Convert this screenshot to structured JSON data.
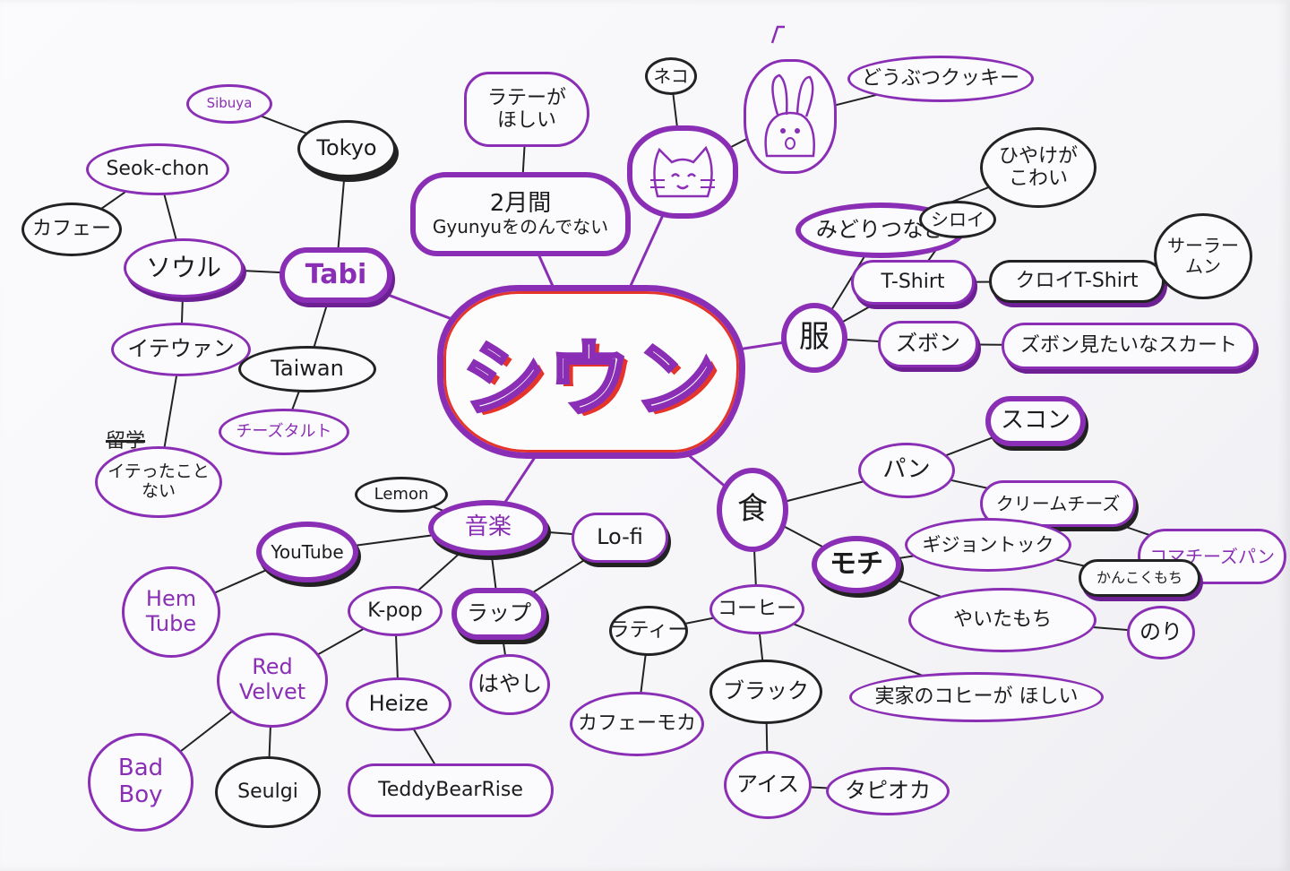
{
  "center": {
    "label": "シウン"
  },
  "nodes": {
    "tabi": "Tabi",
    "tokyo": "Tokyo",
    "shibuya": "Sibuya",
    "seoul": "ソウル",
    "seokchon": "Seok-chon",
    "cafe": "カフェー",
    "itaewon": "イテウァン",
    "taiwan": "Taiwan",
    "cheesetart": "チーズタルト",
    "notbeen_1": "イテったこと",
    "notbeen_2": "ない",
    "gyunyu_1": "2月間",
    "gyunyu_2": "Gyunyuをのんでない",
    "latte_1": "ラテーが",
    "latte_2": "ほしい",
    "neko": "ネコ",
    "animalcookie": "どうぶつクッキー",
    "midori": "みどりつなぎ",
    "hiyake_1": "ひやけが",
    "hiyake_2": "こわい",
    "shiroi": "シロイ",
    "fuku": "服",
    "tshirt": "T-Shirt",
    "kuroi": "クロイT-Shirt",
    "sailor_1": "サーラー",
    "sailor_2": "ムン",
    "zubon": "ズボン",
    "skirt": "ズボン見たいなスカート",
    "shoku": "食",
    "pan": "パン",
    "scone": "スコン",
    "creamcheese": "クリームチーズ",
    "komachi": "コマチーズパン",
    "mochi": "モチ",
    "gijeolttok": "ギジョントック",
    "kankoku": "かんこくもち",
    "yaita": "やいたもち",
    "nori": "のり",
    "coffee": "コーヒー",
    "lattie": "ラティー",
    "cafemocha": "カフェーモカ",
    "black": "ブラック",
    "jikka": "実家のコヒーが ほしい",
    "ice": "アイス",
    "tapioca": "タピオカ",
    "ongaku": "音楽",
    "lemon": "Lemon",
    "lofi": "Lo-fi",
    "youtube": "YouTube",
    "hemtube_1": "Hem",
    "hemtube_2": "Tube",
    "kpop": "K-pop",
    "rap": "ラップ",
    "hayashi": "はやし",
    "redvelvet_1": "Red",
    "redvelvet_2": "Velvet",
    "heize": "Heize",
    "teddy": "TeddyBearRise",
    "badboy_1": "Bad",
    "badboy_2": "Boy",
    "seulgi": "Seulgi"
  },
  "scribble": "留学",
  "icons": {
    "cat": "cat-face-icon",
    "rabbit": "rabbit-face-icon",
    "shrug": "shrug-face-icon"
  },
  "colors": {
    "purple": "#8a2fb5",
    "black": "#222222",
    "red": "#e5352b",
    "paper": "#fbfbfd"
  },
  "links": [
    [
      "center",
      "tabi"
    ],
    [
      "center",
      "gyunyu"
    ],
    [
      "center",
      "neko_cat"
    ],
    [
      "center",
      "fuku"
    ],
    [
      "center",
      "shoku"
    ],
    [
      "center",
      "ongaku"
    ],
    [
      "tabi",
      "tokyo"
    ],
    [
      "tokyo",
      "shibuya"
    ],
    [
      "tabi",
      "seoul"
    ],
    [
      "tabi",
      "taiwan"
    ],
    [
      "seoul",
      "seokchon"
    ],
    [
      "seokchon",
      "cafe"
    ],
    [
      "seoul",
      "itaewon"
    ],
    [
      "itaewon",
      "notbeen"
    ],
    [
      "taiwan",
      "cheesetart"
    ],
    [
      "gyunyu",
      "latte"
    ],
    [
      "neko_cat",
      "neko"
    ],
    [
      "neko_cat",
      "rabbit"
    ],
    [
      "rabbit",
      "animalcookie"
    ],
    [
      "fuku",
      "midori"
    ],
    [
      "midori",
      "hiyake"
    ],
    [
      "fuku",
      "tshirt"
    ],
    [
      "tshirt",
      "shiroi"
    ],
    [
      "tshirt",
      "kuroi"
    ],
    [
      "kuroi",
      "sailor"
    ],
    [
      "fuku",
      "zubon"
    ],
    [
      "zubon",
      "skirt"
    ],
    [
      "shoku",
      "pan"
    ],
    [
      "pan",
      "scone"
    ],
    [
      "pan",
      "creamcheese"
    ],
    [
      "creamcheese",
      "komachi"
    ],
    [
      "shoku",
      "mochi"
    ],
    [
      "mochi",
      "gijeolttok"
    ],
    [
      "gijeolttok",
      "kankoku"
    ],
    [
      "mochi",
      "yaita"
    ],
    [
      "yaita",
      "nori"
    ],
    [
      "shoku",
      "coffee"
    ],
    [
      "coffee",
      "lattie"
    ],
    [
      "lattie",
      "cafemocha"
    ],
    [
      "coffee",
      "black"
    ],
    [
      "coffee",
      "jikka"
    ],
    [
      "black",
      "ice"
    ],
    [
      "ice",
      "tapioca"
    ],
    [
      "ongaku",
      "lemon"
    ],
    [
      "ongaku",
      "lofi"
    ],
    [
      "ongaku",
      "youtube"
    ],
    [
      "youtube",
      "hemtube"
    ],
    [
      "ongaku",
      "kpop"
    ],
    [
      "ongaku",
      "rap"
    ],
    [
      "rap",
      "hayashi"
    ],
    [
      "kpop",
      "redvelvet"
    ],
    [
      "kpop",
      "heize"
    ],
    [
      "heize",
      "teddy"
    ],
    [
      "redvelvet",
      "badboy"
    ],
    [
      "redvelvet",
      "seulgi"
    ],
    [
      "rap",
      "lofi"
    ]
  ]
}
